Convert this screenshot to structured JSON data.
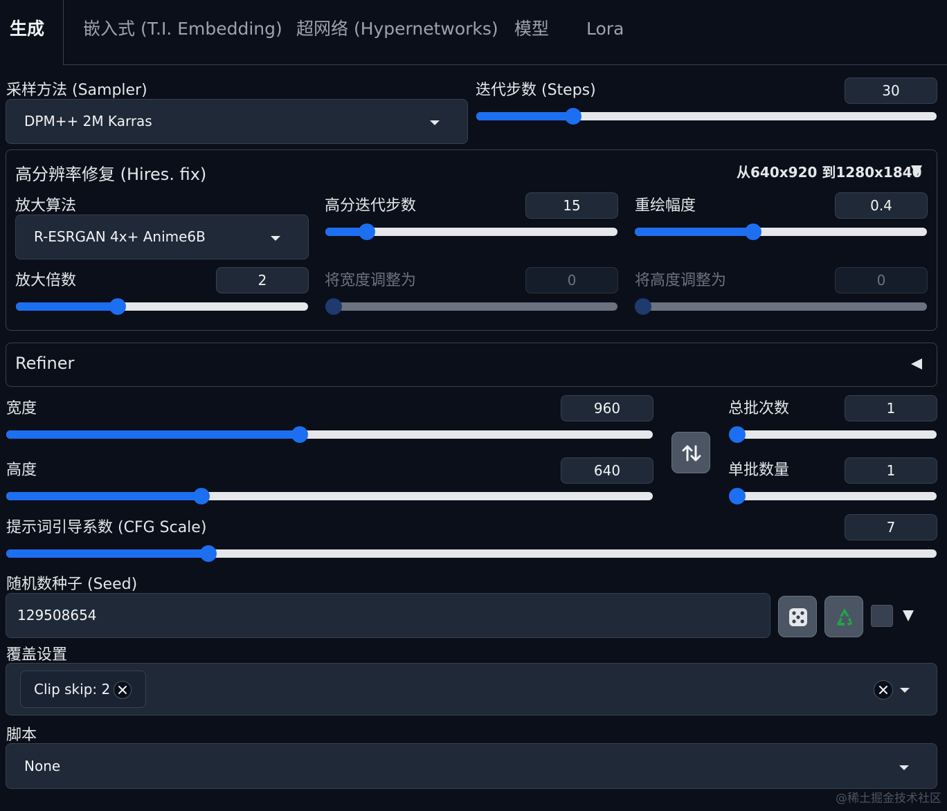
{
  "tabs": [
    "生成",
    "嵌入式 (T.I. Embedding)",
    "超网络 (Hypernetworks)",
    "模型",
    "Lora"
  ],
  "sampler": {
    "label": "采样方法 (Sampler)",
    "value": "DPM++ 2M Karras"
  },
  "steps": {
    "label": "迭代步数 (Steps)",
    "value": "30",
    "fraction": 0.2
  },
  "hires": {
    "title": "高分辨率修复 (Hires. fix)",
    "summary": "从640x920 到1280x1840",
    "upscaler": {
      "label": "放大算法",
      "value": "R-ESRGAN 4x+ Anime6B"
    },
    "hires_steps": {
      "label": "高分迭代步数",
      "value": "15",
      "fraction": 0.12
    },
    "denoise": {
      "label": "重绘幅度",
      "value": "0.4",
      "fraction": 0.4
    },
    "scale": {
      "label": "放大倍数",
      "value": "2",
      "fraction": 0.34
    },
    "resize_w": {
      "label": "将宽度调整为",
      "value": "0",
      "fraction": 0.0
    },
    "resize_h": {
      "label": "将高度调整为",
      "value": "0",
      "fraction": 0.0
    }
  },
  "refiner": {
    "title": "Refiner"
  },
  "width": {
    "label": "宽度",
    "value": "960",
    "fraction": 0.453
  },
  "height": {
    "label": "高度",
    "value": "640",
    "fraction": 0.297
  },
  "batch_count": {
    "label": "总批次数",
    "value": "1",
    "fraction": 0.0
  },
  "batch_size": {
    "label": "单批数量",
    "value": "1",
    "fraction": 0.0
  },
  "cfg": {
    "label": "提示词引导系数 (CFG Scale)",
    "value": "7",
    "fraction": 0.212
  },
  "seed": {
    "label": "随机数种子 (Seed)",
    "value": "129508654"
  },
  "override": {
    "label": "覆盖设置",
    "chip": "Clip skip: 2"
  },
  "script": {
    "label": "脚本",
    "value": "None"
  },
  "watermark": "@稀土掘金技术社区",
  "colors": {
    "accent": "#1d6ff2",
    "background": "#0b0f19",
    "surface": "#1f2937",
    "border": "#374151"
  }
}
